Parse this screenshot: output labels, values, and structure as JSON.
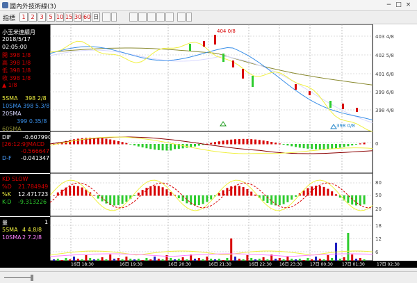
{
  "window": {
    "title": "國內外技術線(3)",
    "buttons": [
      "−",
      "□",
      "×"
    ]
  },
  "toolbar": {
    "label": "指標",
    "periods": [
      "1",
      "2",
      "3",
      "5",
      "10",
      "15",
      "30",
      "60",
      "日"
    ]
  },
  "info": {
    "name": "小玉米連續月",
    "date": "2018/5/17",
    "time": "02:05:00",
    "open": "開 398 1/8",
    "high": "高 398 1/8",
    "low": "低 398 1/8",
    "close": "收 398 1/8",
    "change": "▲ 1/8",
    "sma5_label": "5SMA",
    "sma5_val": "398 2/8",
    "sma10_label": "10SMA",
    "sma10_val": "398 5.3/8",
    "sma20_label": "20SMA",
    "sma20_val": "399 0.35/8",
    "sma60_label": "60SMA"
  },
  "macd": {
    "dif_label": "DIF",
    "dif_val": "-0.607990",
    "macd_label": "[26:12:9]MACD",
    "macd_val": "-0.566647",
    "df_label": "D-F",
    "df_val": "-0.041347"
  },
  "kd": {
    "title": "KD SLOW",
    "d_label": "%D",
    "d_val": "21.784949",
    "k_label": "%K",
    "k_val": "12.471723",
    "kd_label": "K-D",
    "kd_val": "-9.313226"
  },
  "volume": {
    "title": "量",
    "cur": "1",
    "sma5_label": "5SMA",
    "sma5_val": "4 4.8/8",
    "sma10_label": "10SMA",
    "sma10_val": "2 7.2/8"
  },
  "price_axis": [
    "403 4/8",
    "402 5/8",
    "401 6/8",
    "399 6/8",
    "398 4/8"
  ],
  "macd_axis": [
    "0"
  ],
  "kd_axis": [
    "80",
    "50",
    "20"
  ],
  "vol_axis": [
    "18",
    "12",
    "6"
  ],
  "time_axis": [
    "16日 18:30",
    "16日 19:30",
    "16日 20:30",
    "16日 21:30",
    "16日 22:30",
    "16日 23:30",
    "17日 00:30",
    "17日 01:30",
    "17日 02:30"
  ],
  "annotations": {
    "high_mark": "404 0/8",
    "low_mark": "398 0/8"
  },
  "colors": {
    "up": "#d80000",
    "down": "#2ecc2e",
    "sma5": "#f0f040",
    "sma10": "#3a8fe8",
    "sma20": "#d8d8ff",
    "sma60": "#8a8a30"
  }
}
